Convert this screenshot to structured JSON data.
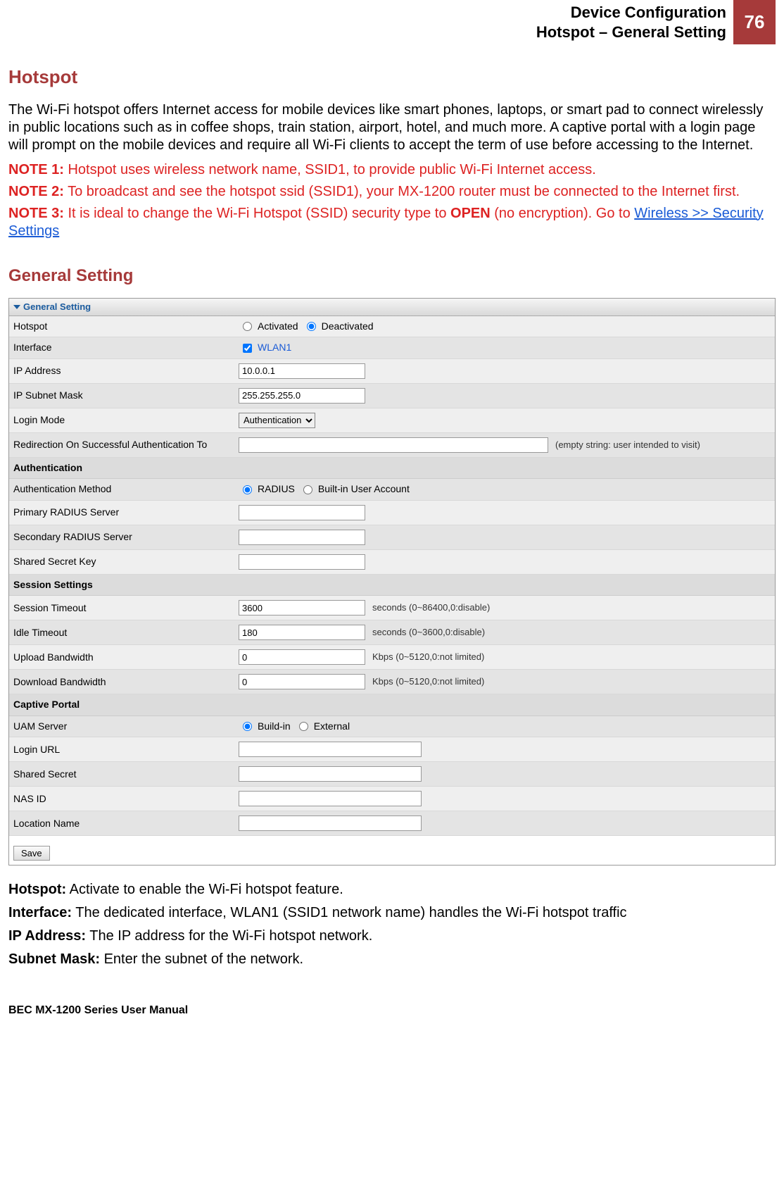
{
  "header": {
    "line1": "Device Configuration",
    "line2": "Hotspot – General Setting",
    "page_number": "76"
  },
  "title": "Hotspot",
  "intro": "The Wi-Fi hotspot offers Internet access for mobile devices like smart phones, laptops, or smart pad to connect wirelessly in public locations such as in coffee shops, train station, airport, hotel, and much more.  A captive portal with a login page will prompt on the mobile devices and require all Wi-Fi clients to accept the term of use before accessing to the Internet.",
  "notes": {
    "n1_label": "NOTE 1:",
    "n1_text": " Hotspot uses wireless network name, SSID1, to provide public Wi-Fi Internet access.",
    "n2_label": "NOTE 2:",
    "n2_text": " To broadcast and see the hotspot ssid (SSID1), your MX-1200 router must be connected to the Internet first.",
    "n3_label": "NOTE 3:",
    "n3_text_a": " It is ideal to change the Wi-Fi Hotspot (SSID) security type to ",
    "n3_bold": "OPEN",
    "n3_text_b": " (no encryption).  Go to ",
    "n3_link": "Wireless >> Security Settings"
  },
  "section_heading": "General Setting",
  "table": {
    "header": "General Setting",
    "rows": {
      "hotspot": {
        "label": "Hotspot",
        "opt1": "Activated",
        "opt2": "Deactivated"
      },
      "interface": {
        "label": "Interface",
        "value": "WLAN1"
      },
      "ip_address": {
        "label": "IP Address",
        "value": "10.0.0.1"
      },
      "ip_subnet": {
        "label": "IP Subnet Mask",
        "value": "255.255.255.0"
      },
      "login_mode": {
        "label": "Login Mode",
        "value": "Authentication"
      },
      "redirect": {
        "label": "Redirection On Successful Authentication To",
        "value": "",
        "hint": "(empty string: user intended to visit)"
      }
    },
    "auth_header": "Authentication",
    "auth_rows": {
      "method": {
        "label": "Authentication Method",
        "opt1": "RADIUS",
        "opt2": "Built-in User Account"
      },
      "primary": {
        "label": "Primary RADIUS Server",
        "value": ""
      },
      "secondary": {
        "label": "Secondary RADIUS Server",
        "value": ""
      },
      "shared": {
        "label": "Shared Secret Key",
        "value": ""
      }
    },
    "session_header": "Session Settings",
    "session_rows": {
      "session_timeout": {
        "label": "Session Timeout",
        "value": "3600",
        "hint": "seconds (0~86400,0:disable)"
      },
      "idle_timeout": {
        "label": "Idle Timeout",
        "value": "180",
        "hint": "seconds (0~3600,0:disable)"
      },
      "upload": {
        "label": "Upload Bandwidth",
        "value": "0",
        "hint": "Kbps (0~5120,0:not limited)"
      },
      "download": {
        "label": "Download Bandwidth",
        "value": "0",
        "hint": "Kbps (0~5120,0:not limited)"
      }
    },
    "captive_header": "Captive Portal",
    "captive_rows": {
      "uam": {
        "label": "UAM Server",
        "opt1": "Build-in",
        "opt2": "External"
      },
      "login_url": {
        "label": "Login URL",
        "value": ""
      },
      "shared_secret": {
        "label": "Shared Secret",
        "value": ""
      },
      "nas_id": {
        "label": "NAS ID",
        "value": ""
      },
      "location": {
        "label": "Location Name",
        "value": ""
      }
    },
    "save": "Save"
  },
  "descriptions": {
    "d1_label": "Hotspot:",
    "d1_text": " Activate to enable the Wi-Fi hotspot feature.",
    "d2_label": "Interface:",
    "d2_text": " The dedicated interface, WLAN1 (SSID1 network name) handles the Wi-Fi hotspot traffic",
    "d3_label": "IP Address:",
    "d3_text": " The IP address for the Wi-Fi hotspot network.",
    "d4_label": "Subnet Mask:",
    "d4_text": " Enter the subnet of the network."
  },
  "footer": "BEC MX-1200 Series User Manual"
}
